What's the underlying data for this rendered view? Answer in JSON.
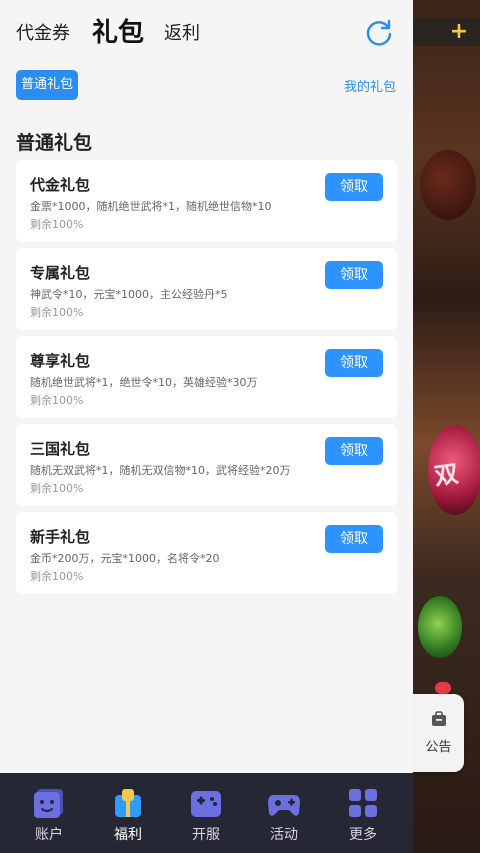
{
  "tabs": {
    "vouchers": "代金券",
    "gifts": "礼包",
    "rebate": "返利"
  },
  "filter": {
    "chip": "普通礼包",
    "my_gifts": "我的礼包"
  },
  "section_title": "普通礼包",
  "packs": [
    {
      "name": "代金礼包",
      "desc": "金票*1000，随机绝世武将*1，随机绝世信物*10",
      "remain": "剩余100%",
      "action": "领取"
    },
    {
      "name": "专属礼包",
      "desc": "神武令*10，元宝*1000，主公经验丹*5",
      "remain": "剩余100%",
      "action": "领取"
    },
    {
      "name": "尊享礼包",
      "desc": "随机绝世武将*1，绝世令*10，英雄经验*30万",
      "remain": "剩余100%",
      "action": "领取"
    },
    {
      "name": "三国礼包",
      "desc": "随机无双武将*1，随机无双信物*10，武将经验*20万",
      "remain": "剩余100%",
      "action": "领取"
    },
    {
      "name": "新手礼包",
      "desc": "金币*200万，元宝*1000，名将令*20",
      "remain": "剩余100%",
      "action": "领取"
    }
  ],
  "notice": {
    "label": "公告",
    "icon": "notice-bag-icon"
  },
  "bottom_nav": [
    {
      "label": "账户",
      "icon": "account-icon"
    },
    {
      "label": "福利",
      "icon": "gift-icon"
    },
    {
      "label": "开服",
      "icon": "gamepad-icon"
    },
    {
      "label": "活动",
      "icon": "controller-icon"
    },
    {
      "label": "更多",
      "icon": "grid-icon"
    }
  ],
  "active_nav": "福利",
  "colors": {
    "accent": "#2b8df0",
    "claim_button": "#2d93ff",
    "nav_bg": "#262735",
    "panel_bg": "#f5f5f6"
  }
}
